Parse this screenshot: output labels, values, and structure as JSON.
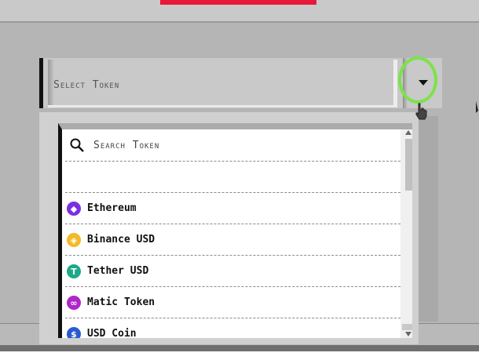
{
  "select": {
    "placeholder": "Select Token",
    "dropdown_icon": "chevron-down-icon"
  },
  "search": {
    "placeholder": "Search Token",
    "icon": "search-icon"
  },
  "tokens": [
    {
      "name": "Ethereum",
      "icon": "ethereum-icon",
      "color": "#7b2fe0",
      "glyph": "◆"
    },
    {
      "name": "Binance USD",
      "icon": "binance-usd-icon",
      "color": "#f3b928",
      "glyph": "◈"
    },
    {
      "name": "Tether USD",
      "icon": "tether-icon",
      "color": "#1ea889",
      "glyph": "T"
    },
    {
      "name": "Matic Token",
      "icon": "matic-icon",
      "color": "#b026c8",
      "glyph": "∞"
    },
    {
      "name": "USD Coin",
      "icon": "usd-coin-icon",
      "color": "#2a5ad1",
      "glyph": "$"
    }
  ],
  "colors": {
    "accent": "#e8173c",
    "highlight_ring": "#7de24a"
  }
}
